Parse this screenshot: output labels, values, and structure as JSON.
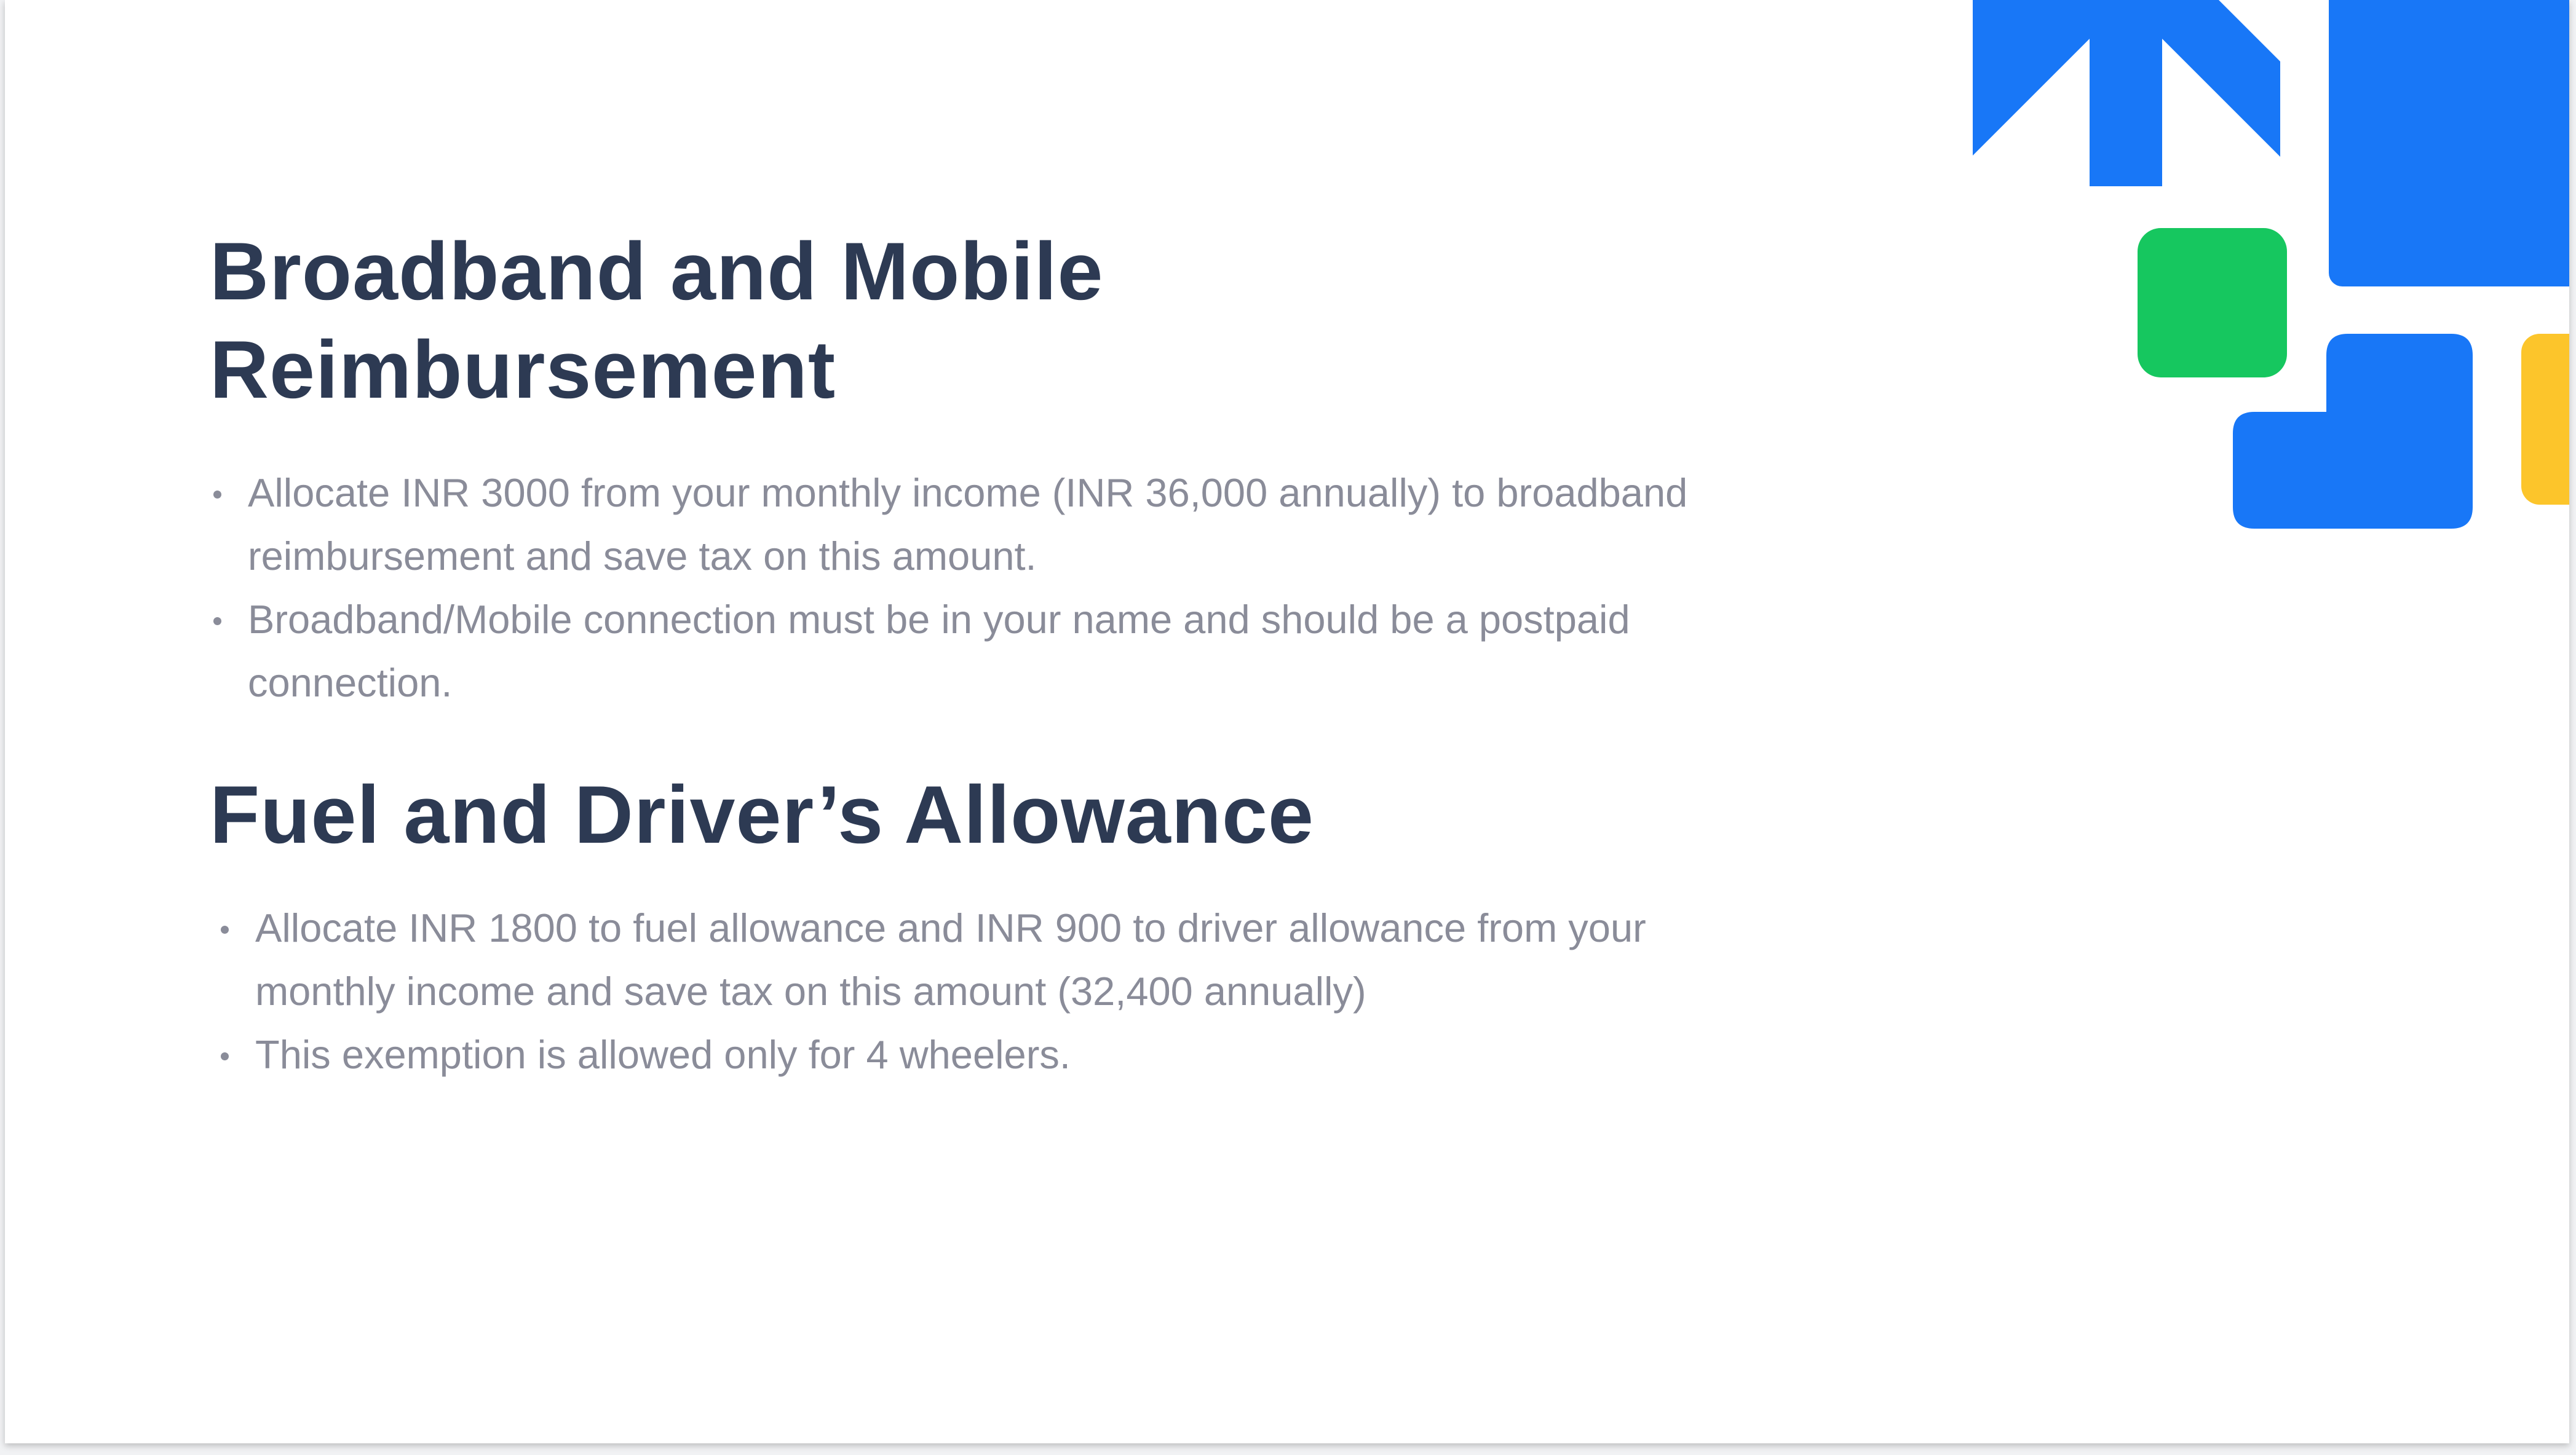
{
  "sections": [
    {
      "title": "Broadband and Mobile Reimbursement",
      "bullets": [
        "Allocate INR 3000 from your monthly income (INR  36,000 annually) to broadband reimbursement  and save tax on this amount.",
        "Broadband/Mobile connection must be in your  name and should be a postpaid connection."
      ]
    },
    {
      "title": "Fuel and Driver’s Allowance",
      "bullets": [
        "Allocate INR 1800 to fuel allowance and INR 900  to driver allowance from your monthly income  and save tax on this amount (32,400 annually)",
        "This exemption is allowed only for 4 wheelers."
      ]
    }
  ],
  "decoration": {
    "colors": {
      "blue": "#1877f7",
      "green": "#16c75f",
      "yellow": "#fcc52b"
    },
    "icons": [
      "arrow-up-shape",
      "green-rounded-square",
      "blue-square",
      "blue-l-shape",
      "yellow-square"
    ]
  }
}
